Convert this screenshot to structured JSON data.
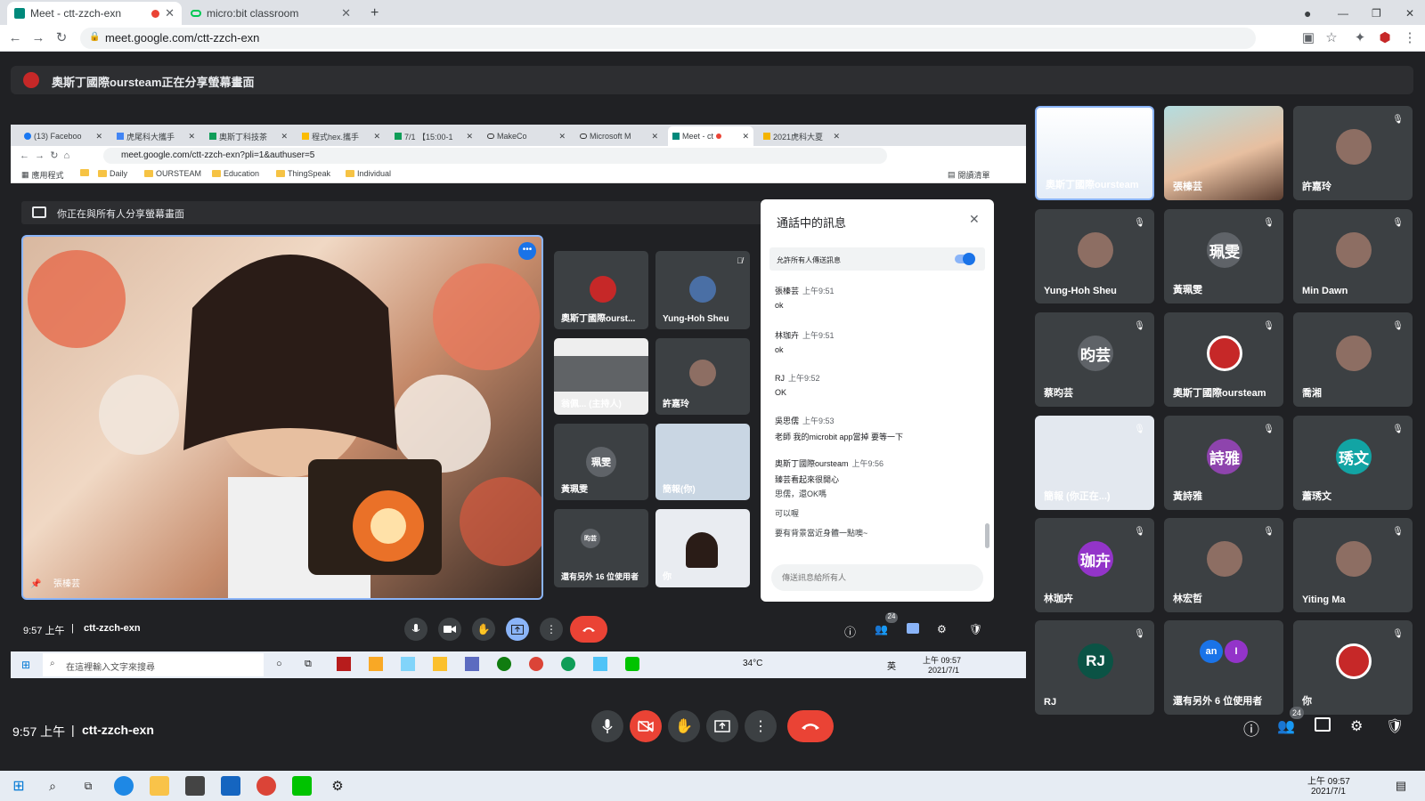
{
  "browser": {
    "tabs": [
      {
        "title": "Meet - ctt-zzch-exn",
        "active": true
      },
      {
        "title": "micro:bit classroom",
        "active": false
      }
    ],
    "new_tab": "+",
    "url": "meet.google.com/ctt-zzch-exn"
  },
  "presenting_banner": "奧斯丁國際oursteam正在分享螢幕畫面",
  "inner": {
    "tabs": [
      "(13) Faceboo",
      "虎尾科大攜手",
      "奧斯丁科技茶",
      "程式hex.攜手",
      "7/1 【15:00-1",
      "MakeCo",
      "Microsoft M",
      "Meet - ct",
      "2021虎科大夏"
    ],
    "url": "meet.google.com/ctt-zzch-exn?pli=1&authuser=5",
    "bookmarks": [
      "應用程式",
      "Daily",
      "OURSTEAM",
      "Education",
      "ThingSpeak",
      "Individual"
    ],
    "reading_list": "閱讀清單",
    "sharing_notice": "你正在與所有人分享螢幕畫面",
    "main_video_name": "張榛芸",
    "small_tiles": [
      {
        "name": "奧斯丁國際ourst..."
      },
      {
        "name": "Yung-Hoh Sheu"
      },
      {
        "name": "翁佩... (主持人)"
      },
      {
        "name": "許嘉玲"
      },
      {
        "name": "黃珮雯",
        "avatar": "珮雯"
      },
      {
        "name": "簡報(你)"
      },
      {
        "name": "還有另外 16 位使用者",
        "avatar": "昀芸"
      },
      {
        "name": "你"
      }
    ],
    "chat": {
      "title": "通話中的訊息",
      "allow_label": "允許所有人傳送訊息",
      "messages": [
        {
          "sender": "張榛芸",
          "time": "上午9:51",
          "text": "ok"
        },
        {
          "sender": "林珈卉",
          "time": "上午9:51",
          "text": "ok"
        },
        {
          "sender": "RJ",
          "time": "上午9:52",
          "text": "OK"
        },
        {
          "sender": "吳思儒",
          "time": "上午9:53",
          "text": "老師 我的microbit app當掉 要等一下"
        },
        {
          "sender": "奧斯丁國際oursteam",
          "time": "上午9:56",
          "text": "臻芸看起來很開心"
        }
      ],
      "extra_lines": [
        "思儒，還OK嗎",
        "可以喔",
        "要有背景當近身體一點噢~"
      ],
      "input_placeholder": "傳送訊息給所有人"
    },
    "time": "9:57 上午",
    "separator": "|",
    "meeting_code": "ctt-zzch-exn",
    "people_count": "24",
    "taskbar": {
      "search": "在這裡輸入文字來搜尋",
      "temp": "34°C",
      "ime": "英",
      "clock_time": "上午 09:57",
      "clock_date": "2021/7/1"
    }
  },
  "grid": [
    {
      "name": "奧斯丁國際oursteam",
      "type": "screen"
    },
    {
      "name": "張榛芸",
      "type": "video"
    },
    {
      "name": "許嘉玲",
      "type": "photo"
    },
    {
      "name": "Yung-Hoh Sheu",
      "type": "photo"
    },
    {
      "name": "黃珮雯",
      "avatar": "珮雯",
      "color": "#5f6368"
    },
    {
      "name": "Min Dawn",
      "type": "photo"
    },
    {
      "name": "蔡昀芸",
      "avatar": "昀芸",
      "color": "#5f6368"
    },
    {
      "name": "奧斯丁國際oursteam",
      "type": "logo"
    },
    {
      "name": "喬湘",
      "type": "photo"
    },
    {
      "name": "簡報 (你正在...)",
      "type": "screen"
    },
    {
      "name": "黃詩雅",
      "avatar": "詩雅",
      "color": "#8e44ad"
    },
    {
      "name": "蕭琇文",
      "avatar": "琇文",
      "color": "#12a4a4"
    },
    {
      "name": "林珈卉",
      "avatar": "珈卉",
      "color": "#9334c9"
    },
    {
      "name": "林宏哲",
      "type": "photo"
    },
    {
      "name": "Yiting Ma",
      "type": "photo"
    },
    {
      "name": "RJ",
      "avatar": "RJ",
      "color": "#0b5345"
    },
    {
      "name": "還有另外 6 位使用者",
      "avatar": "an",
      "avatar2": "I"
    },
    {
      "name": "你",
      "type": "logo"
    }
  ],
  "bottom": {
    "time": "9:57 上午",
    "separator": "|",
    "meeting_code": "ctt-zzch-exn",
    "people_count": "24"
  },
  "taskbar": {
    "clock_time": "上午 09:57",
    "clock_date": "2021/7/1"
  },
  "colors": {
    "accent": "#8ab4f8",
    "end_call": "#ea4335",
    "present": "#8ab4f8",
    "bg": "#202124"
  }
}
